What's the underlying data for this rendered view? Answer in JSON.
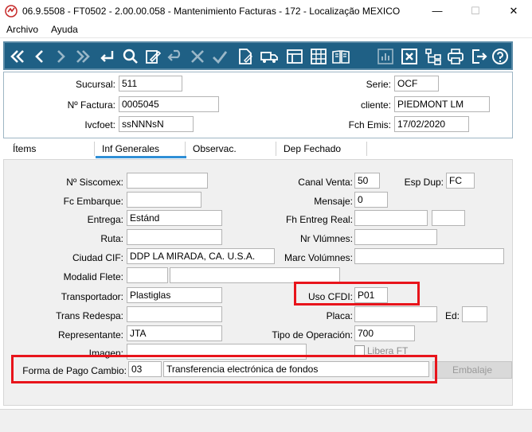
{
  "window": {
    "title": "06.9.5508 - FT0502 - 2.00.00.058 - Mantenimiento Facturas - 172 - Localização MEXICO",
    "minimize": "—",
    "maximize": "☐",
    "close": "✕"
  },
  "menu": {
    "archivo": "Archivo",
    "ayuda": "Ayuda"
  },
  "toolbar_icons": [
    "first-icon",
    "prev-icon",
    "next-icon",
    "last-icon",
    "return-icon",
    "search-icon",
    "edit-icon",
    "undo-icon",
    "delete-icon",
    "confirm-icon",
    "document-icon",
    "truck-icon",
    "layout-icon",
    "calculator-icon",
    "book-icon",
    "chart-icon",
    "close-box-icon",
    "tree-icon",
    "print-icon",
    "exit-icon",
    "help-icon"
  ],
  "header": {
    "sucursal_label": "Sucursal:",
    "sucursal_value": "511",
    "nfactura_label": "Nº Factura:",
    "nfactura_value": "0005045",
    "ivcfoet_label": "Ivcfoet:",
    "ivcfoet_value": "ssNNNsN",
    "serie_label": "Serie:",
    "serie_value": "OCF",
    "cliente_label": "cliente:",
    "cliente_value": "PIEDMONT LM",
    "fchemis_label": "Fch Emis:",
    "fchemis_value": "17/02/2020"
  },
  "tabs": {
    "items": "Ítems",
    "inf_generales": "Inf Generales",
    "observac": "Observac.",
    "dep_fechado": "Dep Fechado"
  },
  "form": {
    "nsiscomex_label": "Nº Siscomex:",
    "nsiscomex_value": "",
    "fcembarque_label": "Fc Embarque:",
    "fcembarque_value": "",
    "entrega_label": "Entrega:",
    "entrega_value": "Estánd",
    "ruta_label": "Ruta:",
    "ruta_value": "",
    "ciudadcif_label": "Ciudad CIF:",
    "ciudadcif_value": "DDP LA MIRADA, CA. U.S.A.",
    "modalid_label": "Modalid Flete:",
    "transportador_label": "Transportador:",
    "transportador_value": "Plastiglas",
    "transredespa_label": "Trans Redespa:",
    "representante_label": "Representante:",
    "representante_value": "JTA",
    "imagen_label": "Imagen:",
    "formapago_label": "Forma de Pago Cambio:",
    "formapago_code": "03",
    "formapago_desc": "Transferencia electrónica de fondos",
    "canalventa_label": "Canal Venta:",
    "canalventa_value": "50",
    "espdup_label": "Esp Dup:",
    "espdup_value": "FC",
    "mensaje_label": "Mensaje:",
    "mensaje_value": "0",
    "fhentreg_label": "Fh Entreg Real:",
    "nrvol_label": "Nr Vlúmnes:",
    "marcvol_label": "Marc Volúmnes:",
    "usocfdi_label": "Uso CFDI:",
    "usocfdi_value": "P01",
    "placa_label": "Placa:",
    "ed_label": "Ed:",
    "tipoop_label": "Tipo de Operación:",
    "tipoop_value": "700",
    "libera_label": "Libera FT",
    "embalaje_label": "Embalaje"
  },
  "colors": {
    "toolbar_bg": "#1f6085",
    "highlight": "#e8141b",
    "tab_underline": "#2f8fd6"
  }
}
